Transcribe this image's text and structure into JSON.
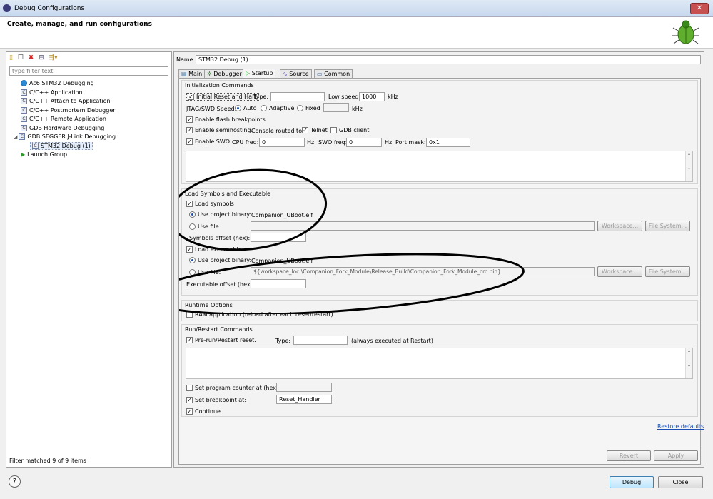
{
  "window": {
    "title": "Debug Configurations",
    "close": "✕"
  },
  "header": {
    "title": "Create, manage, and run configurations"
  },
  "left": {
    "filter_placeholder": "type filter text",
    "tree": [
      {
        "label": "Ac6 STM32 Debugging",
        "icon": "ac6-icon"
      },
      {
        "label": "C/C++ Application",
        "icon": "c-icon"
      },
      {
        "label": "C/C++ Attach to Application",
        "icon": "c-icon"
      },
      {
        "label": "C/C++ Postmortem Debugger",
        "icon": "c-icon"
      },
      {
        "label": "C/C++ Remote Application",
        "icon": "c-icon"
      },
      {
        "label": "GDB Hardware Debugging",
        "icon": "c-icon"
      },
      {
        "label": "GDB SEGGER J-Link Debugging",
        "icon": "c-icon"
      },
      {
        "label": "STM32 Debug (1)",
        "icon": "c-icon"
      },
      {
        "label": "Launch Group",
        "icon": "launch-icon"
      }
    ],
    "status": "Filter matched 9 of 9 items"
  },
  "config": {
    "name_label": "Name:",
    "name_value": "STM32 Debug (1)",
    "tabs": [
      "Main",
      "Debugger",
      "Startup",
      "Source",
      "Common"
    ],
    "init": {
      "title": "Initialization Commands",
      "reset_halt": "Initial Reset and Halt.",
      "type_label": "Type:",
      "low_speed_label": "Low speed:",
      "low_speed_value": "1000",
      "khz": "kHz",
      "jtag_label": "JTAG/SWD Speed:",
      "auto": "Auto",
      "adaptive": "Adaptive",
      "fixed": "Fixed",
      "flash_bp": "Enable flash breakpoints.",
      "semihosting": "Enable semihosting.",
      "console_routed": "Console routed to:",
      "telnet": "Telnet",
      "gdb_client": "GDB client",
      "enable_swo": "Enable SWO.",
      "cpu_freq_label": "CPU freq:",
      "cpu_freq_value": "0",
      "hz": "Hz.",
      "swo_freq_label": "SWO freq:",
      "swo_freq_value": "0",
      "port_mask_label": "Port mask:",
      "port_mask_value": "0x1"
    },
    "load": {
      "title": "Load Symbols and Executable",
      "load_symbols": "Load symbols",
      "use_project_binary": "Use project binary:",
      "symbols_binary": "Companion_UBoot.elf",
      "use_file": "Use file:",
      "workspace": "Workspace...",
      "file_system": "File System...",
      "symbols_offset": "Symbols offset (hex):",
      "load_executable": "Load executable",
      "exe_binary": "Companion_UBoot.elf",
      "exe_file": "${workspace_loc:\\Companion_Fork_Module\\Release_Build\\Companion_Fork_Module_crc.bin}",
      "exe_offset": "Executable offset (hex):"
    },
    "runtime": {
      "title": "Runtime Options",
      "ram_app": "RAM application (reload after each reset/restart)"
    },
    "run": {
      "title": "Run/Restart Commands",
      "pre_run": "Pre-run/Restart reset.",
      "type_label": "Type:",
      "always": "(always executed at Restart)",
      "set_pc": "Set program counter at (hex):",
      "set_bp": "Set breakpoint at:",
      "bp_value": "Reset_Handler",
      "continue": "Continue"
    },
    "restore_defaults": "Restore defaults",
    "revert": "Revert",
    "apply": "Apply"
  },
  "footer": {
    "debug": "Debug",
    "close": "Close",
    "help": "?"
  }
}
